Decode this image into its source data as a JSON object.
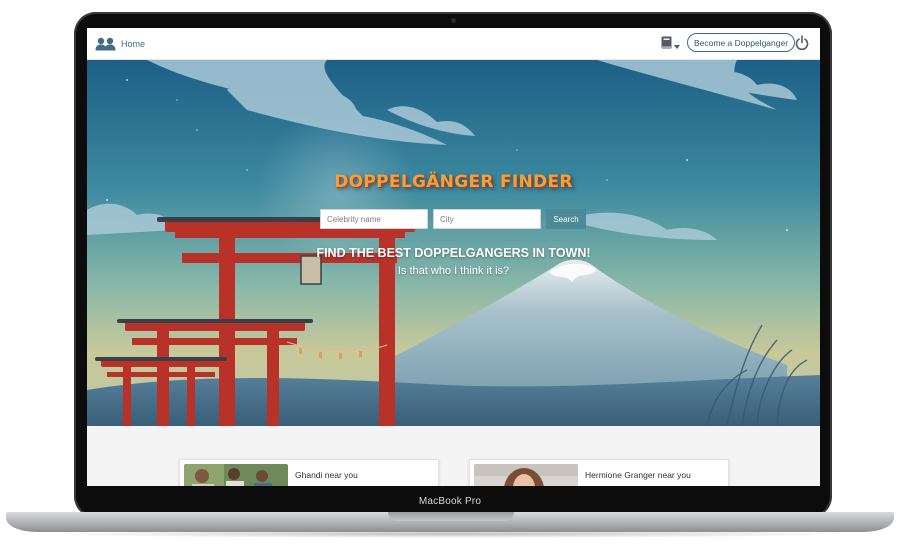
{
  "device": {
    "model_label": "MacBook Pro"
  },
  "navbar": {
    "home_label": "Home",
    "become_label": "Become a Doppelganger"
  },
  "hero": {
    "title": "DOPPELGÄNGER FINDER",
    "search": {
      "celebrity_placeholder": "Celebrity name",
      "city_placeholder": "City",
      "button_label": "Search"
    },
    "tagline": "FIND THE BEST DOPPELGANGERS IN TOWN!",
    "subtitle": "Is that who I think it is?"
  },
  "cards": [
    {
      "title": "Ghandi near you"
    },
    {
      "title": "Hermione Granger near you"
    }
  ],
  "colors": {
    "accent": "#3f6e80",
    "search_button": "#4b8a98",
    "title_orange": "#f0a23a",
    "torii_red": "#b8322a"
  },
  "icons": {
    "home": "users-icon",
    "book": "book-icon",
    "dropdown": "caret-down-icon",
    "power": "power-icon"
  }
}
